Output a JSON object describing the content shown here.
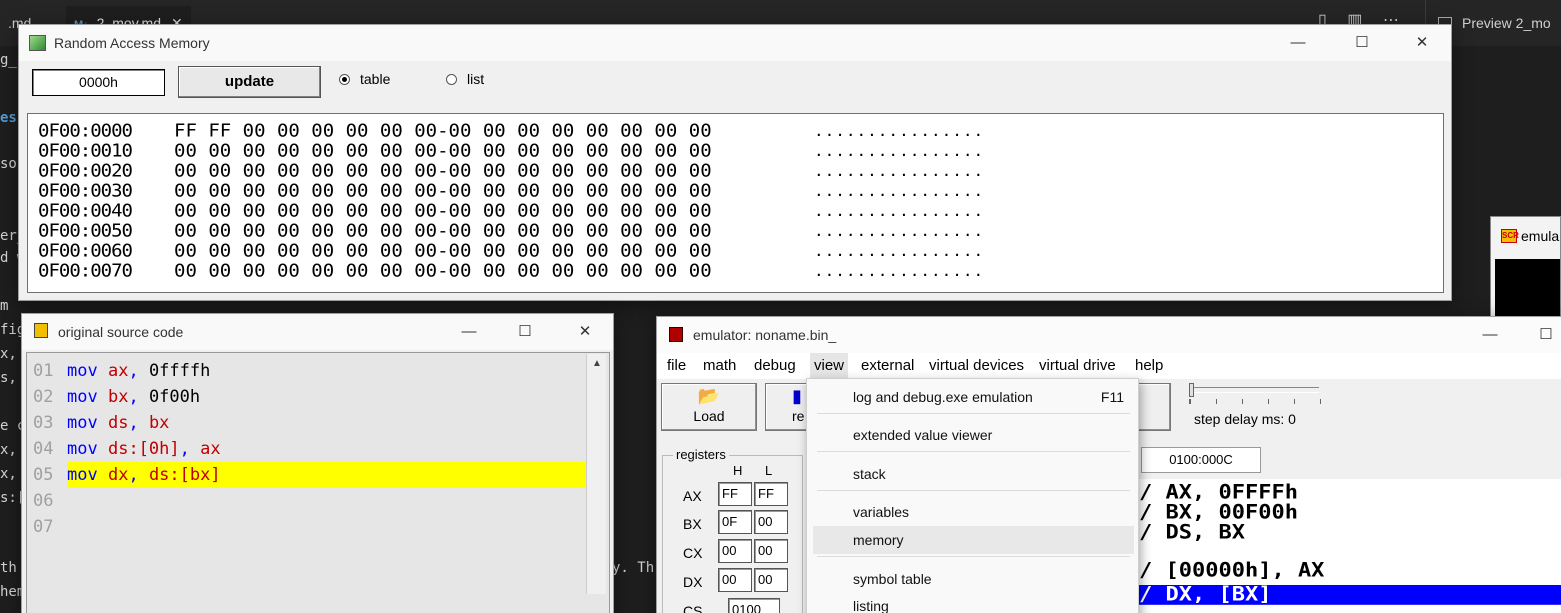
{
  "editor": {
    "tabs": [
      {
        "label": ".md"
      },
      {
        "label": "2_mov.md"
      }
    ],
    "preview_label": "Preview 2_mo",
    "left_fragments": [
      "g_",
      "ess",
      "so",
      "er_",
      "d w",
      "m",
      "fig",
      "x,",
      "s,",
      "e c",
      "x,",
      "x,",
      "s:[",
      "th",
      "hem"
    ],
    "right_fragments": [
      "y. Th"
    ]
  },
  "emul_partial_title": "emula",
  "ram_window": {
    "title": "Random Access Memory",
    "address_value": "0000h",
    "update_label": "update",
    "radio_table": "table",
    "radio_list": "list",
    "rows": [
      {
        "addr": "0F00:0000",
        "bytes": "FF FF 00 00 00 00 00 00-00 00 00 00 00 00 00 00",
        "ascii": "................"
      },
      {
        "addr": "0F00:0010",
        "bytes": "00 00 00 00 00 00 00 00-00 00 00 00 00 00 00 00",
        "ascii": "................"
      },
      {
        "addr": "0F00:0020",
        "bytes": "00 00 00 00 00 00 00 00-00 00 00 00 00 00 00 00",
        "ascii": "................"
      },
      {
        "addr": "0F00:0030",
        "bytes": "00 00 00 00 00 00 00 00-00 00 00 00 00 00 00 00",
        "ascii": "................"
      },
      {
        "addr": "0F00:0040",
        "bytes": "00 00 00 00 00 00 00 00-00 00 00 00 00 00 00 00",
        "ascii": "................"
      },
      {
        "addr": "0F00:0050",
        "bytes": "00 00 00 00 00 00 00 00-00 00 00 00 00 00 00 00",
        "ascii": "................"
      },
      {
        "addr": "0F00:0060",
        "bytes": "00 00 00 00 00 00 00 00-00 00 00 00 00 00 00 00",
        "ascii": "................"
      },
      {
        "addr": "0F00:0070",
        "bytes": "00 00 00 00 00 00 00 00-00 00 00 00 00 00 00 00",
        "ascii": "................"
      }
    ]
  },
  "source_window": {
    "title": "original source code",
    "lines": [
      {
        "num": "01",
        "op": "mov",
        "a": "ax",
        "sep": ", ",
        "b": "0ffffh"
      },
      {
        "num": "02",
        "op": "mov",
        "a": "bx",
        "sep": ", ",
        "b": "0f00h"
      },
      {
        "num": "03",
        "op": "mov",
        "a": "ds",
        "sep": ", ",
        "b": "bx"
      },
      {
        "num": "04",
        "op": "mov",
        "a": "ds:[0h]",
        "sep": ", ",
        "b": "ax"
      },
      {
        "num": "05",
        "op": "mov",
        "a": "dx",
        "sep": ", ",
        "b": "ds:[bx]"
      },
      {
        "num": "06"
      },
      {
        "num": "07"
      }
    ]
  },
  "emulator_window": {
    "title": "emulator: noname.bin_",
    "menu": [
      "file",
      "math",
      "debug",
      "view",
      "external",
      "virtual devices",
      "virtual drive",
      "help"
    ],
    "load_label": "Load",
    "reload_partial": "re",
    "step_delay_label": "step delay ms: 0",
    "registers_legend": "registers",
    "col_h": "H",
    "col_l": "L",
    "registers": [
      {
        "name": "AX",
        "h": "FF",
        "l": "FF"
      },
      {
        "name": "BX",
        "h": "0F",
        "l": "00"
      },
      {
        "name": "CX",
        "h": "00",
        "l": "00"
      },
      {
        "name": "DX",
        "h": "00",
        "l": "00"
      }
    ],
    "cs": {
      "name": "CS",
      "value": "0100"
    },
    "address": "0100:000C",
    "disasm": [
      "/ AX, 0FFFFh",
      "/ BX, 00F00h",
      "/ DS, BX",
      "/ [00000h], AX",
      "/ DX, [BX]"
    ]
  },
  "view_menu": {
    "items": [
      {
        "label": "log and debug.exe emulation",
        "shortcut": "F11"
      },
      {
        "label": "extended value viewer"
      },
      {
        "label": "stack"
      },
      {
        "label": "variables"
      },
      {
        "label": "memory"
      },
      {
        "label": "symbol table"
      },
      {
        "label": "listing"
      }
    ]
  },
  "colors": {
    "highlight_line": "#ffff00",
    "keyword": "#0000ff",
    "register": "#c00000",
    "disasm_highlight": "#0000ff"
  }
}
